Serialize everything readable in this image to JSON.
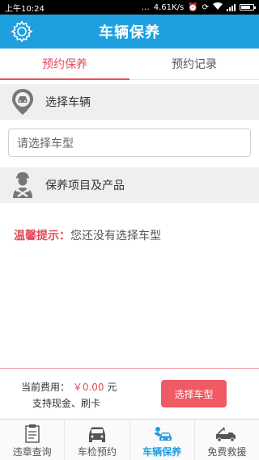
{
  "status_bar": {
    "time": "上午10:24",
    "speed": "4.61K/s"
  },
  "header": {
    "title": "车辆保养"
  },
  "tabs": [
    {
      "label": "预约保养",
      "active": true
    },
    {
      "label": "预约记录",
      "active": false
    }
  ],
  "section_car": {
    "label": "选择车辆"
  },
  "car_select": {
    "placeholder": "请选择车型"
  },
  "section_items": {
    "label": "保养项目及产品"
  },
  "tip": {
    "key": "温馨提示：",
    "text": "您还没有选择车型"
  },
  "fee": {
    "label": "当前费用：",
    "amount": "￥0.00",
    "unit": "元",
    "payment": "支持现金、刷卡",
    "button_label": "选择车型"
  },
  "bottom_nav": [
    {
      "label": "违章查询",
      "icon": "document-icon"
    },
    {
      "label": "车检预约",
      "icon": "car-front-icon"
    },
    {
      "label": "车辆保养",
      "icon": "car-maintenance-icon",
      "active": true
    },
    {
      "label": "免费救援",
      "icon": "tow-truck-icon"
    }
  ],
  "colors": {
    "accent_blue": "#1e9fe0",
    "accent_red": "#e44b5b",
    "button_red": "#ef5a64"
  }
}
